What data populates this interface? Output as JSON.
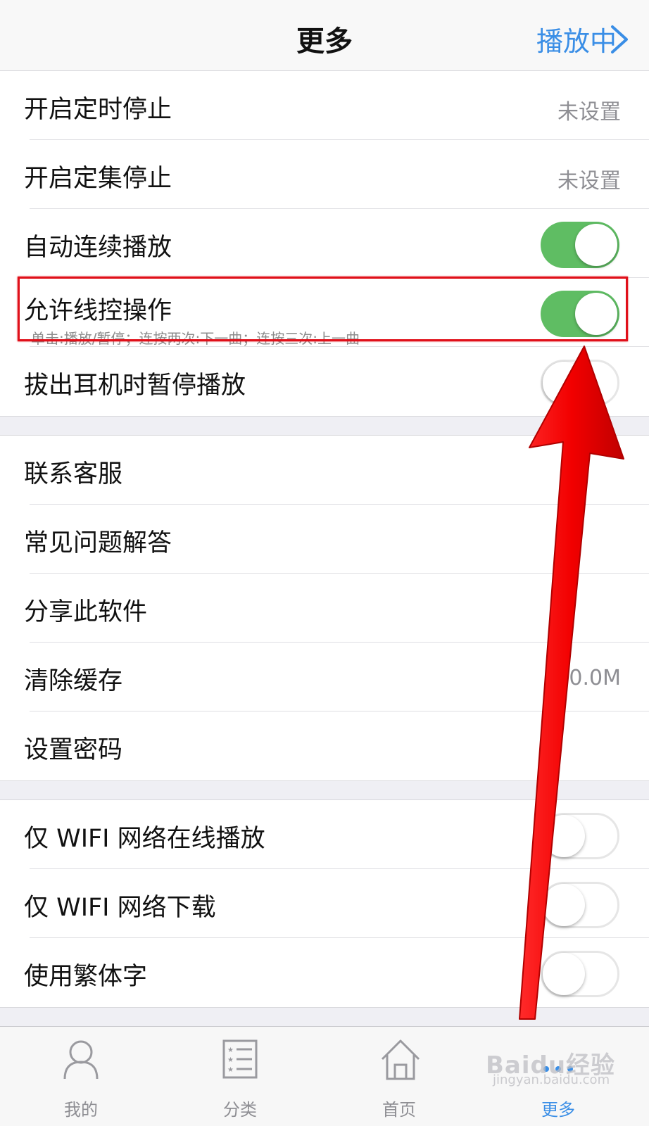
{
  "nav": {
    "title": "更多",
    "playing": "播放中"
  },
  "group1": [
    {
      "label": "开启定时停止",
      "value": "未设置"
    },
    {
      "label": "开启定集停止",
      "value": "未设置"
    },
    {
      "label": "自动连续播放",
      "toggle": "on"
    },
    {
      "label": "允许线控操作",
      "sub": "单击:播放/暂停；连按两次:下一曲；连按三次:上一曲",
      "toggle": "on"
    },
    {
      "label": "拔出耳机时暂停播放",
      "toggle": "off"
    }
  ],
  "group2": [
    {
      "label": "联系客服"
    },
    {
      "label": "常见问题解答"
    },
    {
      "label": "分享此软件"
    },
    {
      "label": "清除缓存",
      "value": "0.0M"
    },
    {
      "label": "设置密码"
    }
  ],
  "group3": [
    {
      "label": "仅 WIFI 网络在线播放",
      "toggle": "off"
    },
    {
      "label": "仅 WIFI 网络下载",
      "toggle": "off"
    },
    {
      "label": "使用繁体字",
      "toggle": "off"
    }
  ],
  "tabs": [
    {
      "label": "我的",
      "icon": "person-icon"
    },
    {
      "label": "分类",
      "icon": "list-icon"
    },
    {
      "label": "首页",
      "icon": "home-icon"
    },
    {
      "label": "更多",
      "icon": "more-icon",
      "active": true
    }
  ],
  "watermark": {
    "main": "Baidu经验",
    "url": "jingyan.baidu.com"
  },
  "colors": {
    "accent": "#3a8ee6",
    "toggle_on": "#5fbd63",
    "annotation": "#e0101a"
  }
}
